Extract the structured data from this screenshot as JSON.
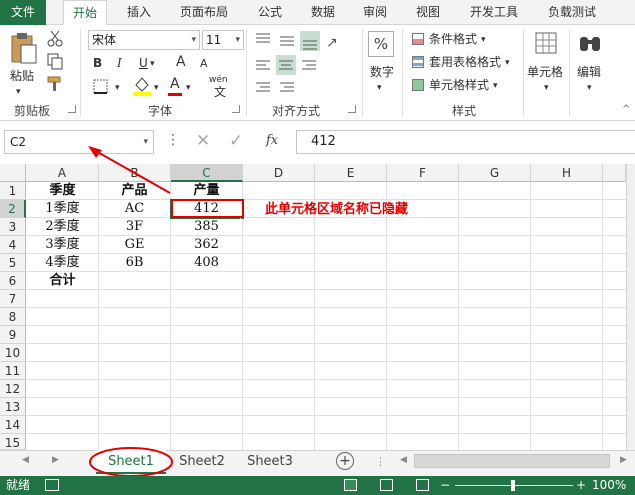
{
  "ribbon_tabs": [
    "文件",
    "开始",
    "插入",
    "页面布局",
    "公式",
    "数据",
    "审阅",
    "视图",
    "开发工具",
    "负载测试"
  ],
  "clipboard": {
    "paste_label": "粘贴",
    "group_label": "剪贴板"
  },
  "font": {
    "name": "宋体",
    "size": "11",
    "bold": "B",
    "italic": "I",
    "underline": "U",
    "grow": "A",
    "shrink": "A",
    "phonetic": "wén",
    "group_label": "字体"
  },
  "alignment": {
    "group_label": "对齐方式"
  },
  "number": {
    "label": "数字"
  },
  "styles": {
    "conditional": "条件格式",
    "table": "套用表格格式",
    "cell": "单元格样式",
    "group_label": "样式"
  },
  "cells": {
    "label": "单元格"
  },
  "editing": {
    "label": "编辑"
  },
  "formula_bar": {
    "name_box": "C2",
    "fx": "fx",
    "value": "412"
  },
  "columns": [
    "A",
    "B",
    "C",
    "D",
    "E",
    "F",
    "G",
    "H"
  ],
  "rows": [
    "1",
    "2",
    "3",
    "4",
    "5",
    "6",
    "7",
    "8",
    "9",
    "10",
    "11",
    "12",
    "13",
    "14",
    "15"
  ],
  "table": {
    "headers": [
      "季度",
      "产品",
      "产量"
    ],
    "data": [
      [
        "1季度",
        "AC",
        "412"
      ],
      [
        "2季度",
        "3F",
        "385"
      ],
      [
        "3季度",
        "GE",
        "362"
      ],
      [
        "4季度",
        "6B",
        "408"
      ]
    ],
    "total_label": "合计"
  },
  "annotation": "此单元格区域名称已隐藏",
  "sheets": [
    "Sheet1",
    "Sheet2",
    "Sheet3"
  ],
  "status": {
    "ready": "就绪",
    "zoom": "100%"
  },
  "colors": {
    "excel_green": "#217346",
    "annotation_red": "#e60000"
  }
}
